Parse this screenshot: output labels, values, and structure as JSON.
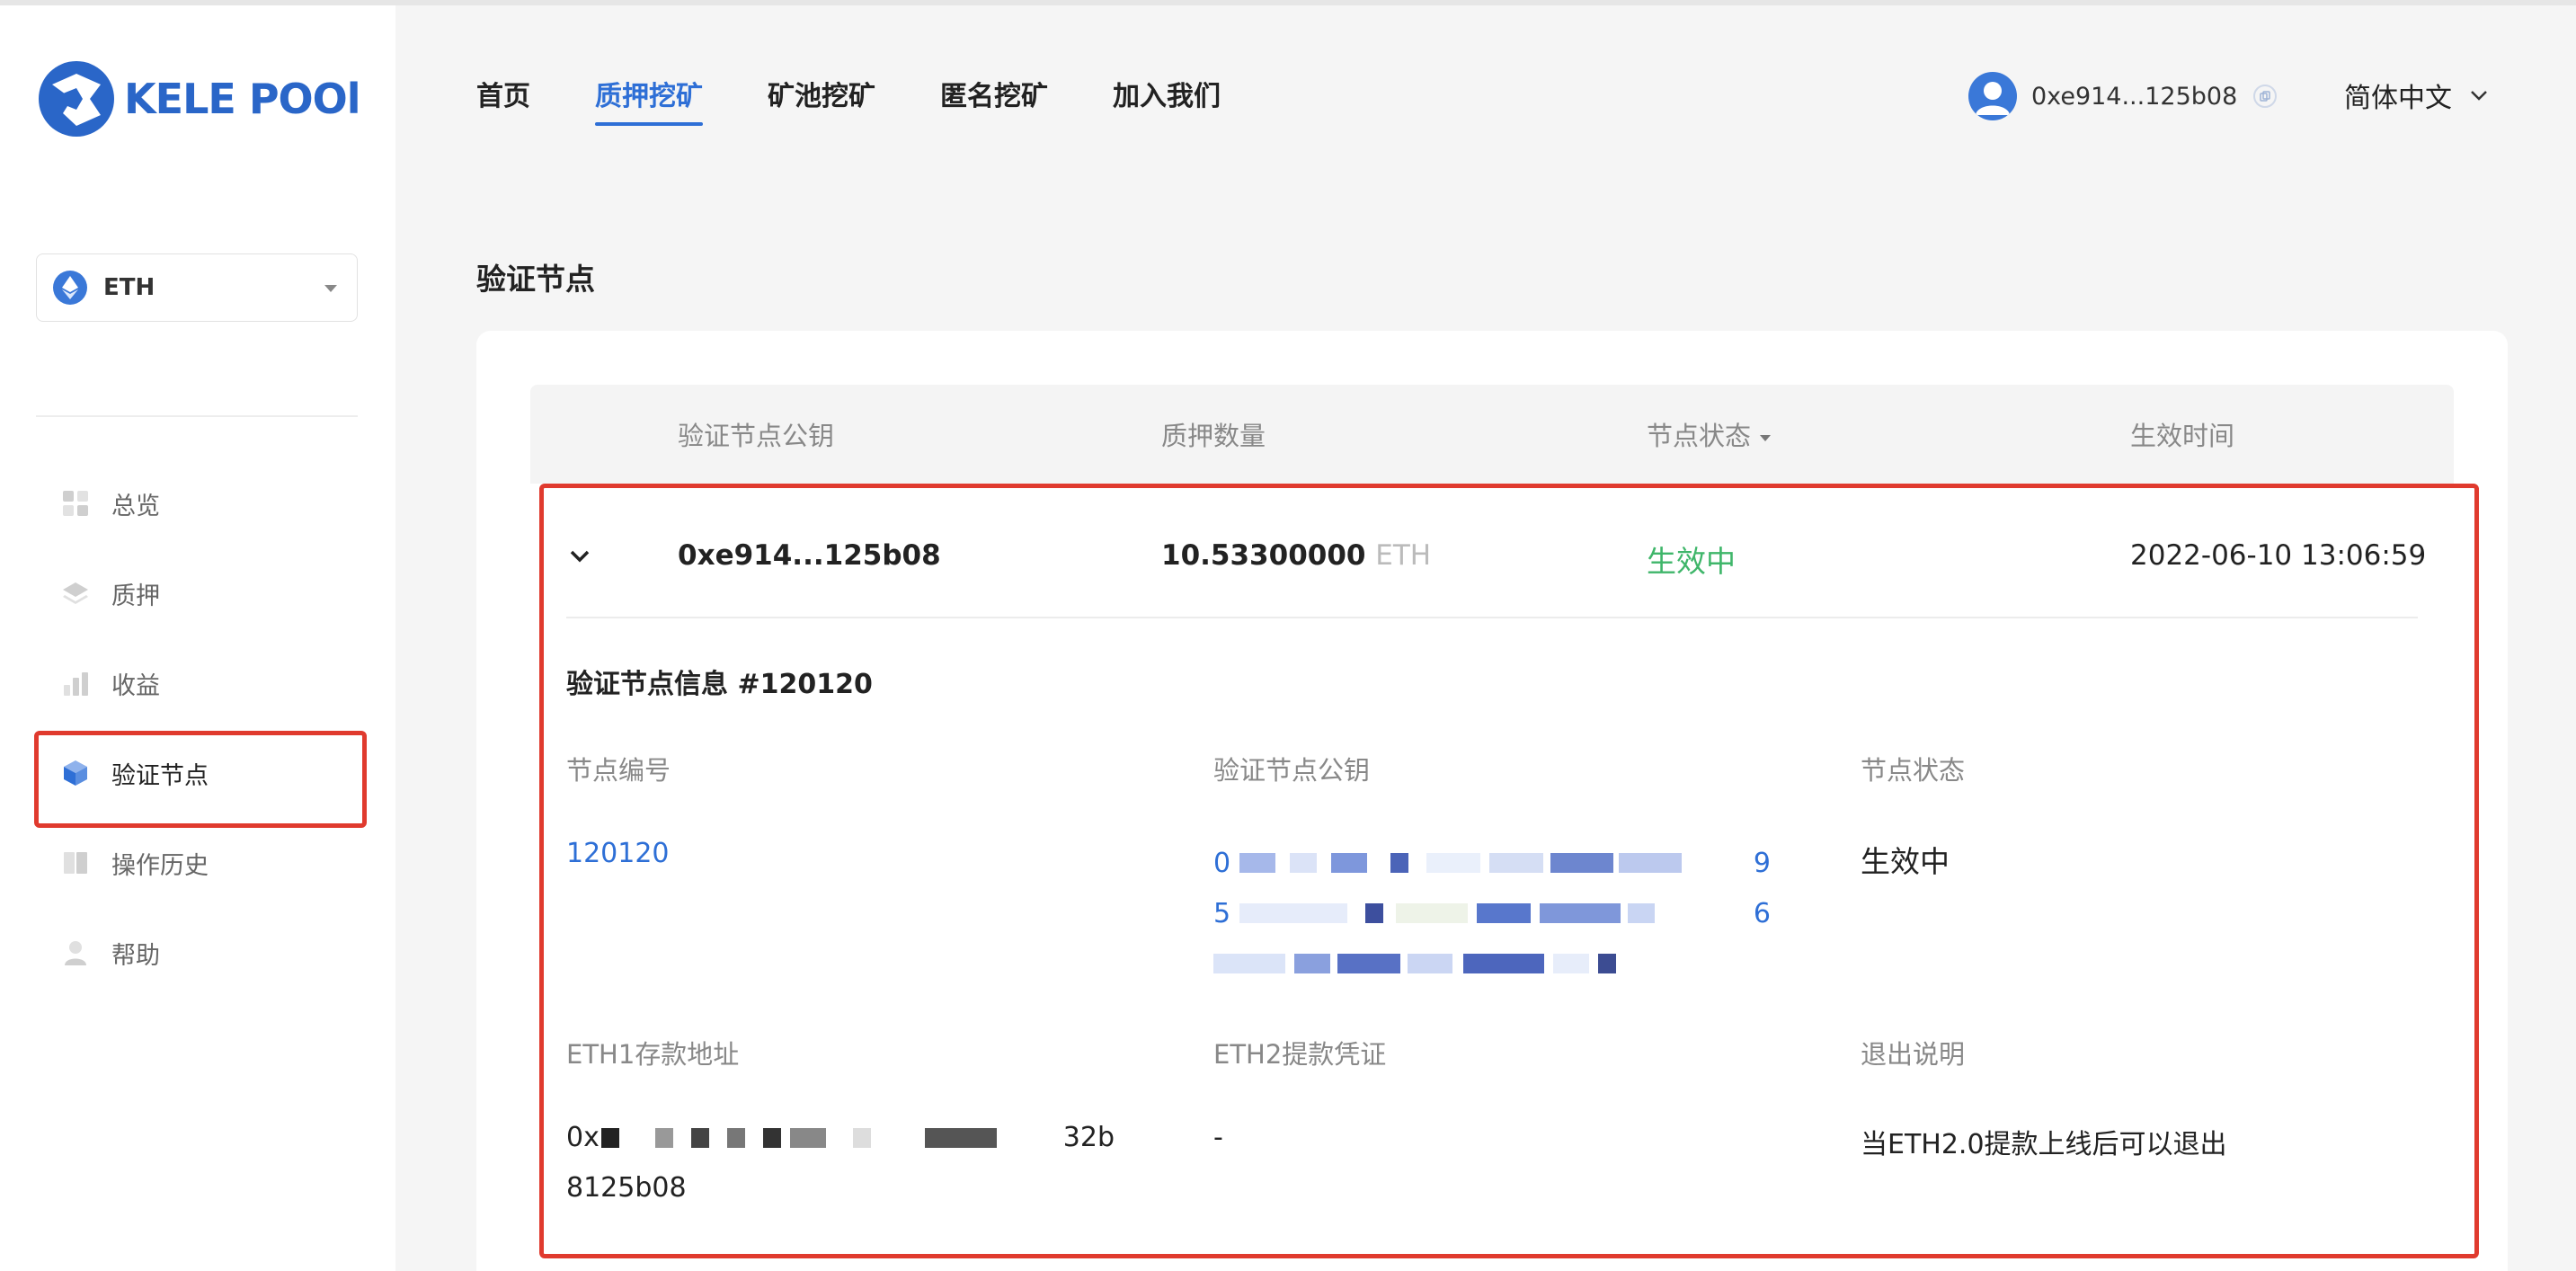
{
  "brand": {
    "name": "KELE POOl"
  },
  "sidebar": {
    "coin_select": {
      "value": "ETH"
    },
    "items": [
      {
        "label": "总览",
        "icon": "grid-icon"
      },
      {
        "label": "质押",
        "icon": "layers-icon"
      },
      {
        "label": "收益",
        "icon": "bar-chart-icon"
      },
      {
        "label": "验证节点",
        "icon": "cube-icon",
        "active": true
      },
      {
        "label": "操作历史",
        "icon": "book-icon"
      },
      {
        "label": "帮助",
        "icon": "user-help-icon"
      }
    ]
  },
  "header": {
    "tabs": [
      {
        "label": "首页"
      },
      {
        "label": "质押挖矿",
        "active": true
      },
      {
        "label": "矿池挖矿"
      },
      {
        "label": "匿名挖矿"
      },
      {
        "label": "加入我们"
      }
    ],
    "wallet_address": "0xe914...125b08",
    "language": "简体中文"
  },
  "page": {
    "title": "验证节点"
  },
  "table": {
    "columns": [
      "验证节点公钥",
      "质押数量",
      "节点状态",
      "生效时间"
    ],
    "row": {
      "pubkey": "0xe914...125b08",
      "amount": "10.53300000",
      "unit": "ETH",
      "status": "生效中",
      "time": "2022-06-10 13:06:59"
    }
  },
  "detail": {
    "title": "验证节点信息 #120120",
    "labels": {
      "node_id": "节点编号",
      "pubkey": "验证节点公钥",
      "status": "节点状态",
      "eth1_address": "ETH1存款地址",
      "eth2_credential": "ETH2提款凭证",
      "exit_note": "退出说明"
    },
    "values": {
      "node_id": "120120",
      "pubkey_line1_start": "0",
      "pubkey_line1_end": "9",
      "pubkey_line2_start": "5",
      "pubkey_line2_end": "6",
      "status": "生效中",
      "eth1_line1_start": "0x",
      "eth1_line1_end": "32b",
      "eth1_line2": "8125b08",
      "eth2_credential": "-",
      "exit_note": "当ETH2.0提款上线后可以退出"
    }
  },
  "colors": {
    "accent": "#2e6fd6",
    "active_status": "#3fb66a",
    "highlight_frame": "#e03a2e"
  }
}
